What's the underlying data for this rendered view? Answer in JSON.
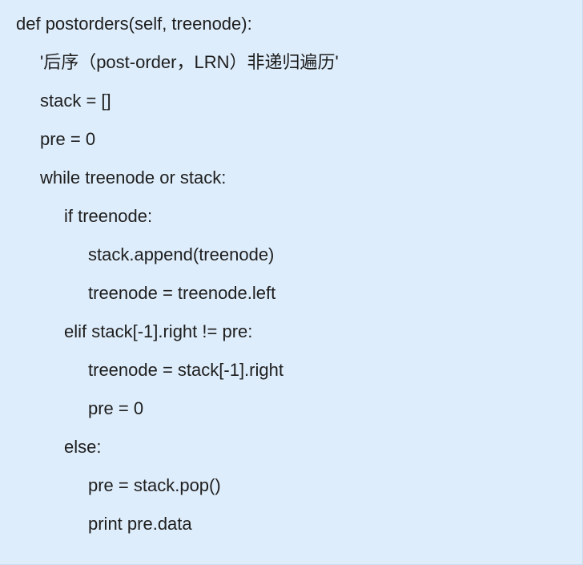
{
  "code": {
    "lines": [
      "def postorders(self, treenode):",
      "'后序（post-order，LRN）非递归遍历'",
      "stack = []",
      "pre = 0",
      "while treenode or stack:",
      "if treenode:",
      "stack.append(treenode)",
      "treenode = treenode.left",
      "elif stack[-1].right != pre:",
      "treenode = stack[-1].right",
      "pre = 0",
      "else:",
      "pre = stack.pop()",
      "print pre.data"
    ]
  }
}
